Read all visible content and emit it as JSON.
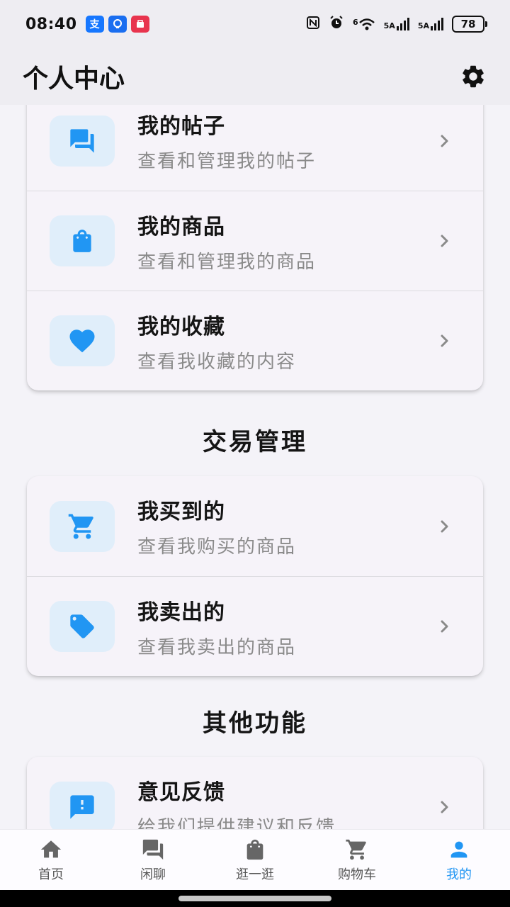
{
  "status_bar": {
    "time": "08:40",
    "apps": [
      {
        "name": "alipay-icon",
        "glyph": "支",
        "color": "#1677ff"
      },
      {
        "name": "bulb-app-icon",
        "glyph": "◎",
        "color": "#1a6ef0"
      },
      {
        "name": "store-app-icon",
        "glyph": "▣",
        "color": "#e8344e"
      }
    ],
    "network1": "6",
    "network2": "5A",
    "network3": "5A",
    "battery": "78"
  },
  "header": {
    "title": "个人中心"
  },
  "group_personal": {
    "items": [
      {
        "title": "我的帖子",
        "subtitle": "查看和管理我的帖子",
        "icon": "forum-icon"
      },
      {
        "title": "我的商品",
        "subtitle": "查看和管理我的商品",
        "icon": "shopping-bag-icon"
      },
      {
        "title": "我的收藏",
        "subtitle": "查看我收藏的内容",
        "icon": "heart-icon"
      }
    ]
  },
  "section_trade": {
    "title": "交易管理",
    "items": [
      {
        "title": "我买到的",
        "subtitle": "查看我购买的商品",
        "icon": "cart-icon"
      },
      {
        "title": "我卖出的",
        "subtitle": "查看我卖出的商品",
        "icon": "tag-icon"
      }
    ]
  },
  "section_other": {
    "title": "其他功能",
    "items": [
      {
        "title": "意见反馈",
        "subtitle": "给我们提供建议和反馈",
        "icon": "feedback-icon"
      }
    ]
  },
  "bottom_nav": {
    "items": [
      {
        "label": "首页",
        "icon": "home-icon"
      },
      {
        "label": "闲聊",
        "icon": "chat-icon"
      },
      {
        "label": "逛一逛",
        "icon": "bag-icon"
      },
      {
        "label": "购物车",
        "icon": "cart-icon"
      },
      {
        "label": "我的",
        "icon": "person-icon"
      }
    ],
    "active_index": 4
  },
  "colors": {
    "accent": "#2196f3",
    "icon_bg": "#e0eefa",
    "nav_inactive_icon": "#666666"
  }
}
